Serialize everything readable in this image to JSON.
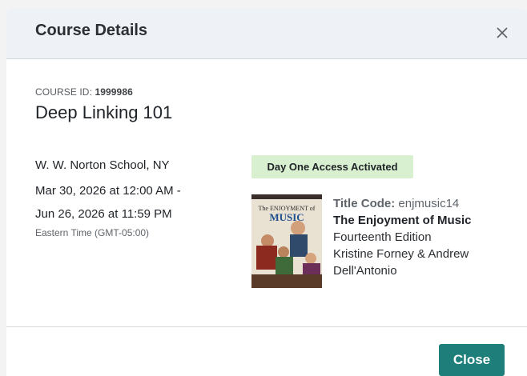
{
  "modal": {
    "title": "Course Details",
    "close_icon": "close-icon"
  },
  "course": {
    "id_label": "COURSE ID:",
    "id_value": "1999986",
    "name": "Deep Linking 101",
    "school": "W. W. Norton School, NY",
    "date_start": "Mar 30, 2026 at 12:00 AM -",
    "date_end": "Jun 26, 2026 at 11:59 PM",
    "timezone": "Eastern Time (GMT-05:00)"
  },
  "access": {
    "badge": "Day One Access Activated",
    "badge_color": "#d8f0cf"
  },
  "book": {
    "cover_text_top": "The ENJOYMENT of",
    "cover_text_main": "MUSIC",
    "title_code_label": "Title Code:",
    "title_code_value": "enjmusic14",
    "title": "The Enjoyment of Music",
    "edition": "Fourteenth Edition",
    "authors": "Kristine Forney & Andrew Dell'Antonio"
  },
  "footer": {
    "close_label": "Close",
    "accent_color": "#1e7f7a"
  }
}
